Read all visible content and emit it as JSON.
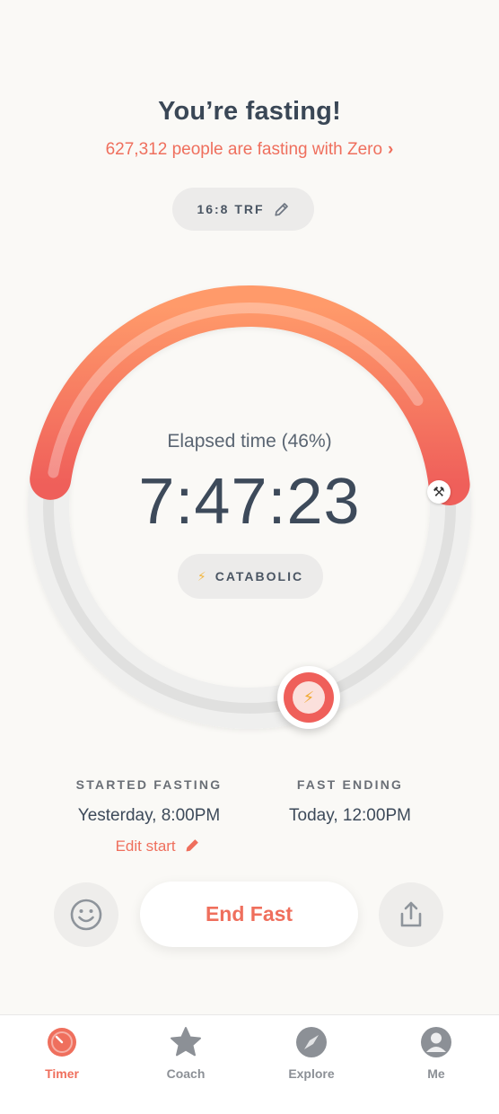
{
  "header": {
    "title": "You’re fasting!",
    "community_text": "627,312 people are fasting with Zero",
    "community_chevron": "›"
  },
  "plan": {
    "label": "16:8 TRF",
    "icon": "pencil-icon"
  },
  "timer": {
    "elapsed_label": "Elapsed time (46%)",
    "elapsed_time": "7:47:23",
    "progress_fraction": 0.46,
    "stage_label": "CATABOLIC",
    "stage_icon": "lightning-icon",
    "milestone_icon": "tools-icon",
    "accent_color": "#ef5f5a",
    "accent_start_color": "#ff9a6a"
  },
  "fast_details": {
    "started_heading": "STARTED FASTING",
    "started_value": "Yesterday, 8:00PM",
    "edit_start_label": "Edit start",
    "ending_heading": "FAST ENDING",
    "ending_value": "Today, 12:00PM"
  },
  "actions": {
    "end_fast_label": "End Fast"
  },
  "tabbar": {
    "items": [
      {
        "label": "Timer",
        "icon": "timer-icon",
        "active": true
      },
      {
        "label": "Coach",
        "icon": "star-icon",
        "active": false
      },
      {
        "label": "Explore",
        "icon": "compass-icon",
        "active": false
      },
      {
        "label": "Me",
        "icon": "person-icon",
        "active": false
      }
    ]
  }
}
